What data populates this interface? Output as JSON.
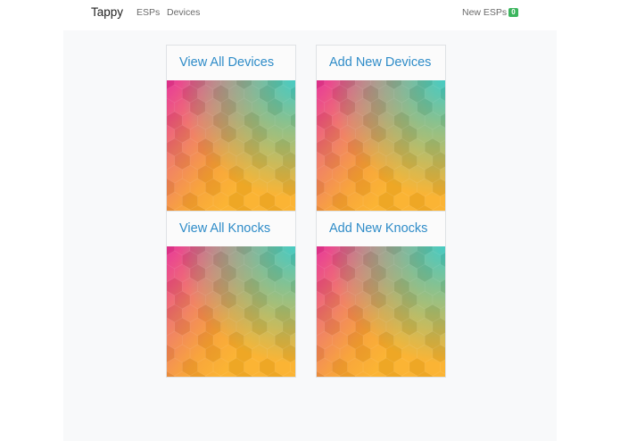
{
  "navbar": {
    "brand": "Tappy",
    "links": [
      "ESPs",
      "Devices"
    ],
    "new_esps_label": "New ESPs",
    "new_esps_count": "0"
  },
  "cards": [
    {
      "title": "View All Devices"
    },
    {
      "title": "Add New Devices"
    },
    {
      "title": "View All Knocks"
    },
    {
      "title": "Add New Knocks"
    }
  ],
  "colors": {
    "link": "#2f8cc8",
    "badge": "#3cb55e",
    "gradient": [
      "#e8338f",
      "#f07860",
      "#f8a030",
      "#fbb028",
      "#3cc8c0"
    ]
  }
}
